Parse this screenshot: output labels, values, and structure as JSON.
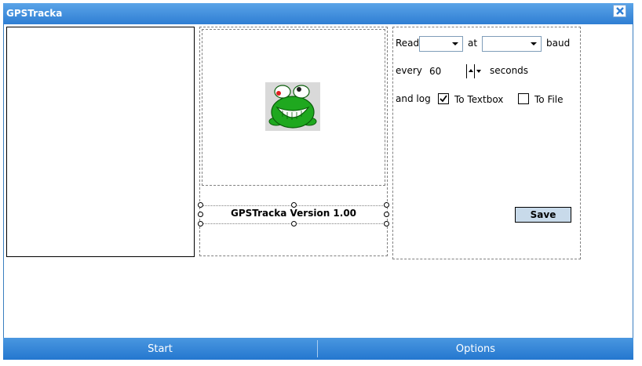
{
  "window": {
    "title": "GPSTracka"
  },
  "center": {
    "version_label": "GPSTracka Version 1.00"
  },
  "settings": {
    "read_label": "Read",
    "port_value": "",
    "at_label": "at",
    "baud_value": "",
    "baud_label": "baud",
    "every_label": "every",
    "interval_value": "60",
    "seconds_label": "seconds",
    "and_log_label": "and log",
    "to_textbox_label": "To Textbox",
    "to_textbox_checked": true,
    "to_file_label": "To File",
    "to_file_checked": false,
    "save_label": "Save"
  },
  "menu": {
    "left_label": "Start",
    "right_label": "Options"
  },
  "colors": {
    "title_bar": "#2f7ed3",
    "menu_bar": "#2477cf",
    "save_button": "#c8daea",
    "frog_green": "#1fa81f"
  },
  "icons": {
    "close": "close-x-icon",
    "frog": "frog-logo-icon"
  }
}
